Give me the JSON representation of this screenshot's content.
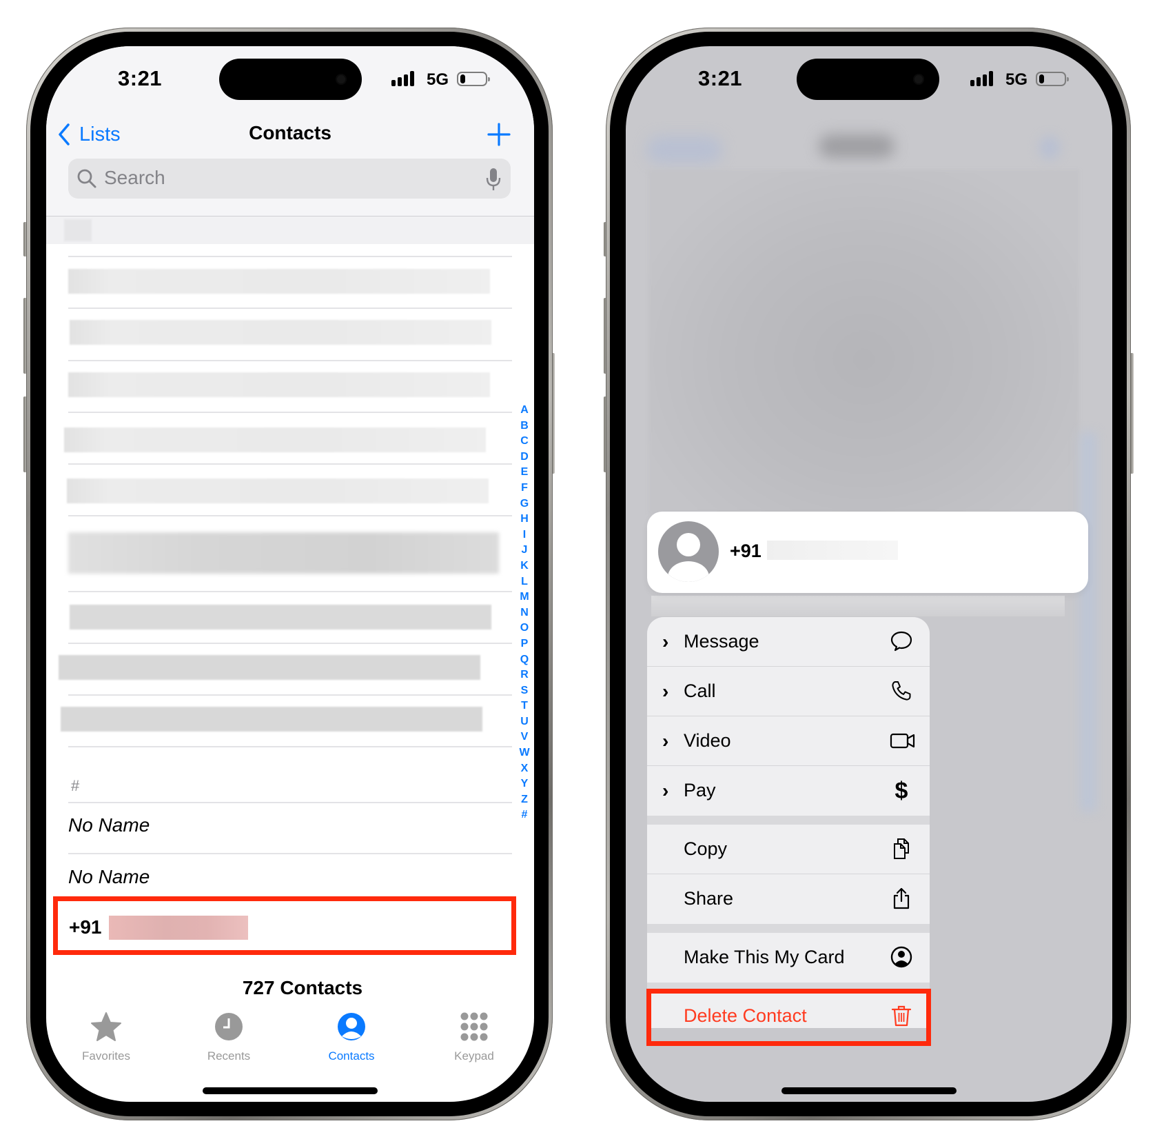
{
  "left_phone": {
    "status_bar": {
      "time": "3:21",
      "network": "5G"
    },
    "nav": {
      "back_label": "Lists",
      "title": "Contacts",
      "add_icon": "plus-icon"
    },
    "search": {
      "placeholder": "Search",
      "search_icon": "magnifier-icon",
      "mic_icon": "microphone-icon"
    },
    "index_letters": [
      "A",
      "B",
      "C",
      "D",
      "E",
      "F",
      "G",
      "H",
      "I",
      "J",
      "K",
      "L",
      "M",
      "N",
      "O",
      "P",
      "Q",
      "R",
      "S",
      "T",
      "U",
      "V",
      "W",
      "X",
      "Y",
      "Z",
      "#"
    ],
    "blurred_rows_count": 9,
    "section_header": "#",
    "rows": [
      {
        "label": "No Name"
      },
      {
        "label": "No Name"
      },
      {
        "label": "+91",
        "highlighted": true,
        "redacted": true
      }
    ],
    "contacts_count": "727 Contacts",
    "tabs": [
      {
        "label": "Favorites",
        "icon": "star-icon",
        "active": false
      },
      {
        "label": "Recents",
        "icon": "clock-icon",
        "active": false
      },
      {
        "label": "Contacts",
        "icon": "person-circle-icon",
        "active": true
      },
      {
        "label": "Keypad",
        "icon": "keypad-icon",
        "active": false
      }
    ]
  },
  "right_phone": {
    "status_bar": {
      "time": "3:21",
      "network": "5G"
    },
    "contact_card": {
      "number_prefix": "+91",
      "redacted": true
    },
    "menu": {
      "sections": [
        [
          {
            "label": "Message",
            "has_submenu": true,
            "icon": "message-bubble-icon"
          },
          {
            "label": "Call",
            "has_submenu": true,
            "icon": "phone-icon"
          },
          {
            "label": "Video",
            "has_submenu": true,
            "icon": "video-camera-icon"
          },
          {
            "label": "Pay",
            "has_submenu": true,
            "icon": "dollar-icon"
          }
        ],
        [
          {
            "label": "Copy",
            "has_submenu": false,
            "icon": "copy-icon"
          },
          {
            "label": "Share",
            "has_submenu": false,
            "icon": "share-icon"
          }
        ],
        [
          {
            "label": "Make This My Card",
            "has_submenu": false,
            "icon": "person-circle-icon"
          }
        ],
        [
          {
            "label": "Delete Contact",
            "has_submenu": false,
            "icon": "trash-icon",
            "destructive": true,
            "highlighted": true
          }
        ]
      ]
    }
  },
  "colors": {
    "accent": "#0a7aff",
    "destructive": "#ff3b20",
    "highlight_box": "#ff2a0c"
  },
  "submenu_chevron": "›"
}
